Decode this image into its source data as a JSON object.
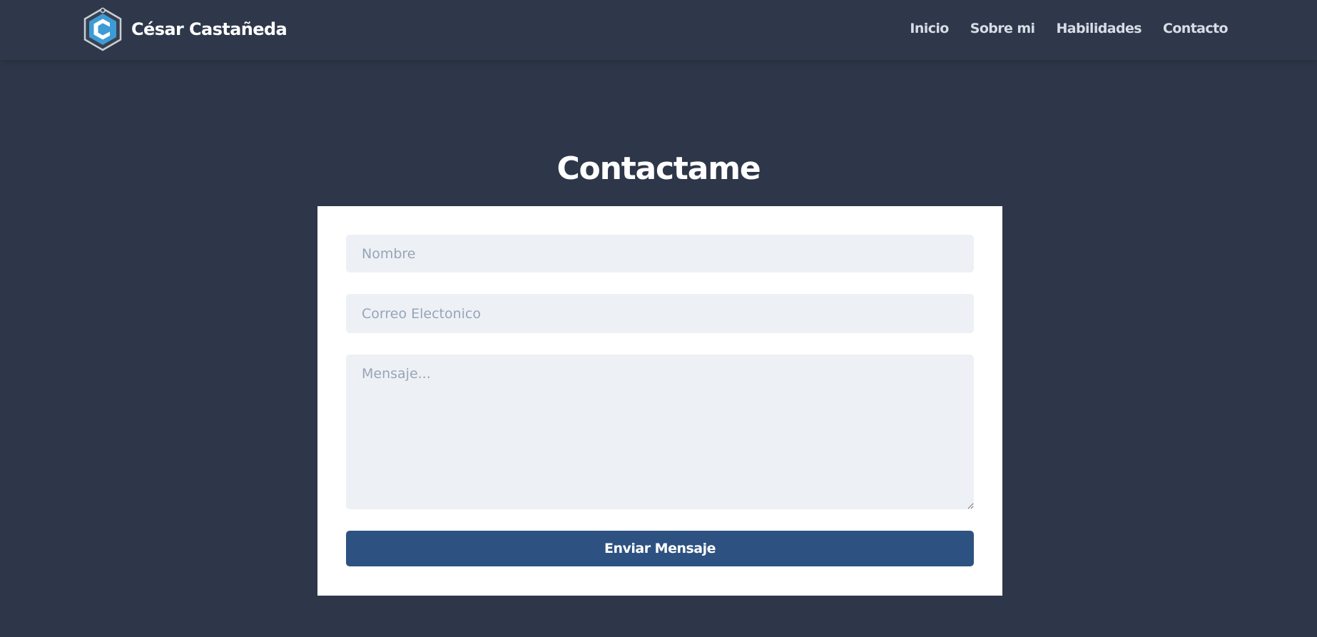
{
  "navbar": {
    "brand_name": "César Castañeda",
    "logo_icon": "hexagon-c-logo-icon",
    "links": [
      {
        "label": "Inicio"
      },
      {
        "label": "Sobre mi"
      },
      {
        "label": "Habilidades"
      },
      {
        "label": "Contacto"
      }
    ]
  },
  "contact": {
    "title": "Contactame",
    "name_placeholder": "Nombre",
    "email_placeholder": "Correo Electonico",
    "message_placeholder": "Mensaje...",
    "submit_label": "Enviar Mensaje"
  },
  "colors": {
    "page_background": "#2e3749",
    "navbar_background": "#2f384a",
    "card_background": "#ffffff",
    "field_background": "#edf1f5",
    "button_background": "#2d5281",
    "logo_accent": "#3d9bd6"
  }
}
